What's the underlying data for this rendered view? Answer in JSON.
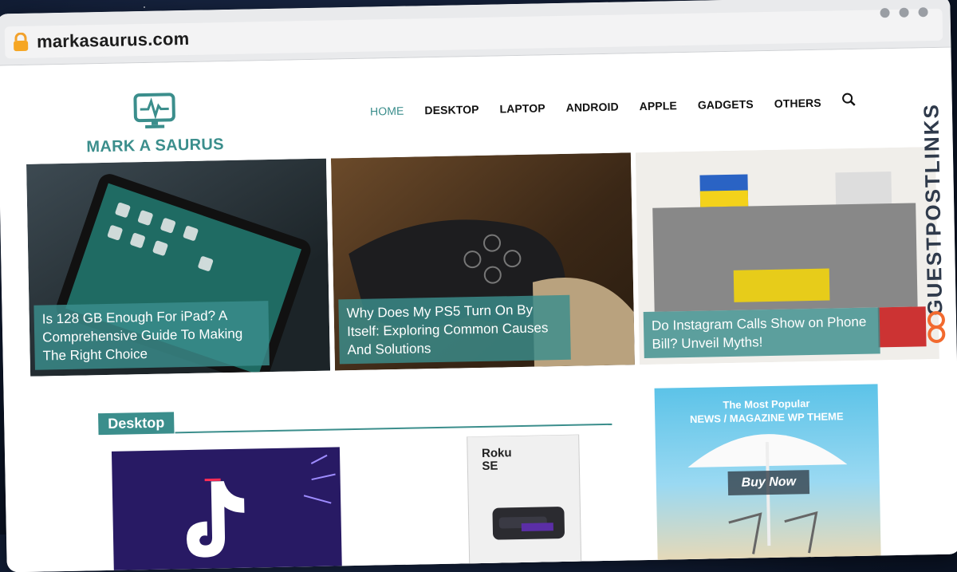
{
  "browser": {
    "url": "markasaurus.com"
  },
  "site": {
    "logo_text": "MARK A SAURUS",
    "nav": [
      "HOME",
      "DESKTOP",
      "LAPTOP",
      "ANDROID",
      "APPLE",
      "GADGETS",
      "OTHERS"
    ],
    "accent_color": "#3b8e8c"
  },
  "hero": [
    {
      "caption": "Is 128 GB Enough For iPad? A Comprehensive Guide To Making The Right Choice"
    },
    {
      "caption": "Why Does My PS5 Turn On By Itself: Exploring Common Causes And Solutions"
    },
    {
      "caption": "Do Instagram Calls Show on Phone Bill? Unveil Myths!"
    }
  ],
  "section": {
    "title": "Desktop"
  },
  "product": {
    "brand": "Roku",
    "model": "SE"
  },
  "ad": {
    "headline_line1": "The Most Popular",
    "headline_line2": "NEWS / MAGAZINE WP THEME",
    "button": "Buy Now"
  },
  "watermark": "GUESTPOSTLINKS"
}
